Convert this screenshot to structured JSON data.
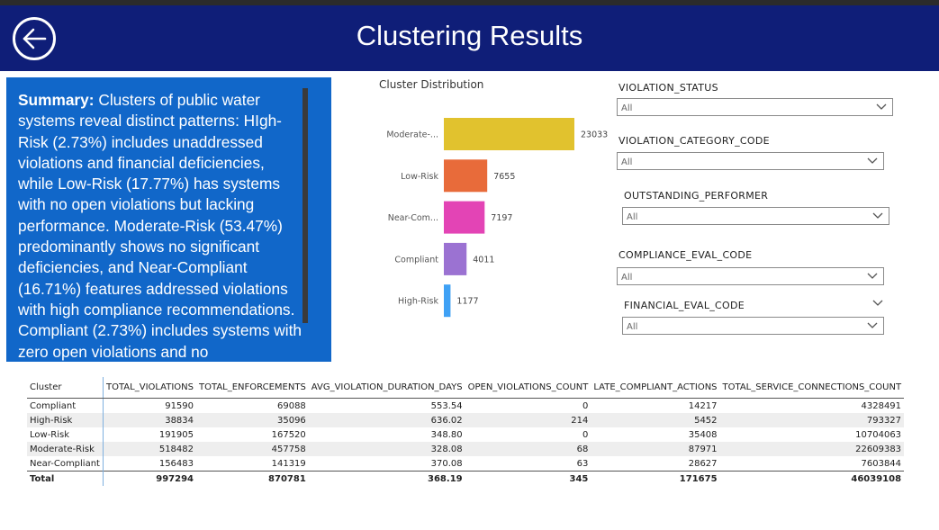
{
  "header": {
    "title": "Clustering Results",
    "back_icon": "back-arrow-circle-icon",
    "background_color": "#0f1e78"
  },
  "summary": {
    "label": "Summary:",
    "text": " Clusters of public water systems reveal distinct patterns: HIgh-Risk (2.73%) includes unaddressed violations and financial deficiencies, while Low-Risk (17.77%) has systems with no open violations but lacking performance. Moderate-Risk (53.47%) predominantly shows no significant deficiencies, and Near-Compliant (16.71%) features addressed violations with high compliance recommendations. Compliant (2.73%) includes systems with zero open violations and no",
    "background_color": "#1167c9"
  },
  "chart_data": {
    "type": "bar",
    "orientation": "horizontal",
    "title": "Cluster Distribution",
    "categories": [
      "Moderate-...",
      "Low-Risk",
      "Near-Com...",
      "Compliant",
      "High-Risk"
    ],
    "values": [
      23033,
      7655,
      7197,
      4011,
      1177
    ],
    "colors": [
      "#e1c22e",
      "#e86b3a",
      "#e344b5",
      "#9b72d2",
      "#3fa1f5"
    ],
    "xlim": [
      0,
      23033
    ],
    "grid": false,
    "data_labels": true
  },
  "slicers": [
    {
      "label": "VIOLATION_STATUS",
      "value": "All"
    },
    {
      "label": "VIOLATION_CATEGORY_CODE",
      "value": "All"
    },
    {
      "label": "OUTSTANDING_PERFORMER",
      "value": "All"
    },
    {
      "label": "COMPLIANCE_EVAL_CODE",
      "value": "All"
    },
    {
      "label": "FINANCIAL_EVAL_CODE",
      "value": "All"
    }
  ],
  "table": {
    "columns": [
      "Cluster",
      "TOTAL_VIOLATIONS",
      "TOTAL_ENFORCEMENTS",
      "AVG_VIOLATION_DURATION_DAYS",
      "OPEN_VIOLATIONS_COUNT",
      "LATE_COMPLIANT_ACTIONS",
      "TOTAL_SERVICE_CONNECTIONS_COUNT"
    ],
    "rows": [
      [
        "Compliant",
        "91590",
        "69088",
        "553.54",
        "0",
        "14217",
        "4328491"
      ],
      [
        "High-Risk",
        "38834",
        "35096",
        "636.02",
        "214",
        "5452",
        "793327"
      ],
      [
        "Low-Risk",
        "191905",
        "167520",
        "348.80",
        "0",
        "35408",
        "10704063"
      ],
      [
        "Moderate-Risk",
        "518482",
        "457758",
        "328.08",
        "68",
        "87971",
        "22609383"
      ],
      [
        "Near-Compliant",
        "156483",
        "141319",
        "370.08",
        "63",
        "28627",
        "7603844"
      ]
    ],
    "total": [
      "Total",
      "997294",
      "870781",
      "368.19",
      "345",
      "171675",
      "46039108"
    ]
  }
}
